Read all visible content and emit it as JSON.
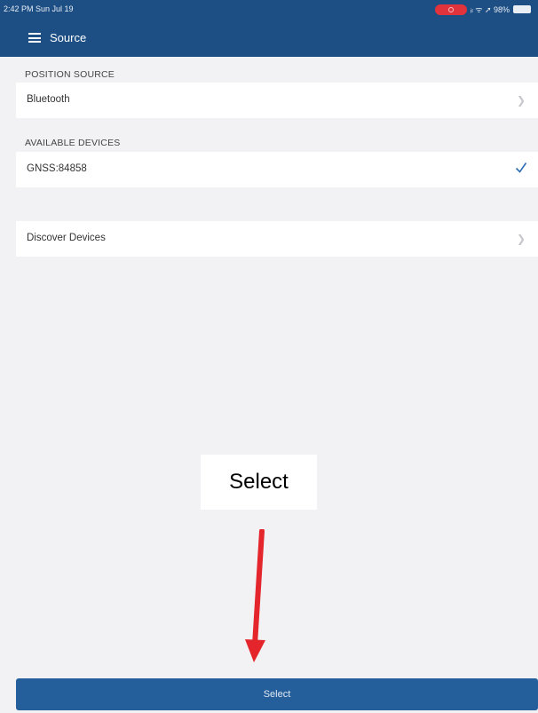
{
  "status_bar": {
    "time": "2:42 PM  Sun Jul 19",
    "indicators": "ᵢₗ ᯤ ➚ 98%",
    "recording_color": "#e0333c"
  },
  "nav": {
    "title": "Source",
    "menu_icon": "hamburger-menu-icon",
    "background": "#1d4f85"
  },
  "position_source": {
    "header": "POSITION SOURCE",
    "value": "Bluetooth"
  },
  "available_devices": {
    "header": "AVAILABLE DEVICES",
    "items": [
      {
        "label": "GNSS:84858",
        "selected": true
      }
    ]
  },
  "discover": {
    "label": "Discover Devices"
  },
  "annotation": {
    "callout_text": "Select",
    "arrow_color": "#e4252c"
  },
  "footer": {
    "select_label": "Select",
    "button_color": "#245f9c"
  }
}
